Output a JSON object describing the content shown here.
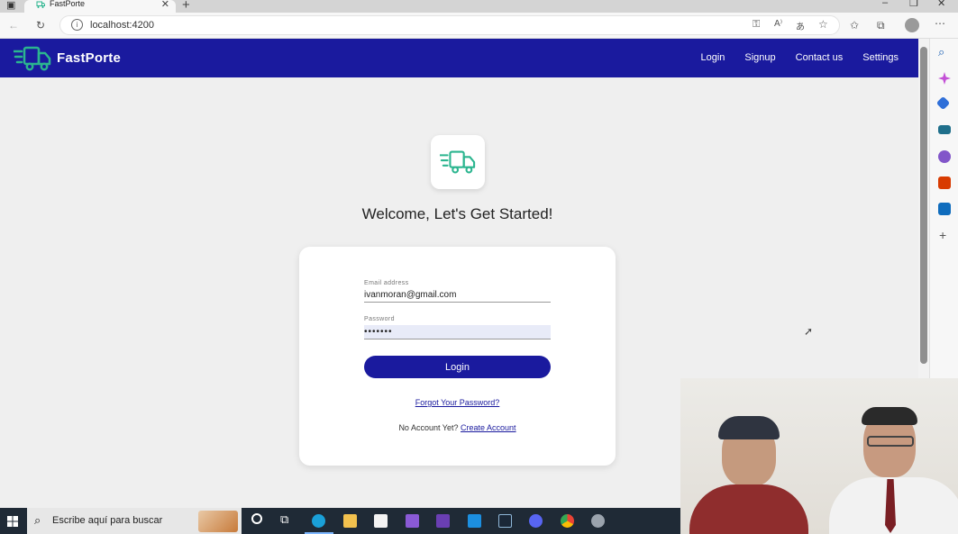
{
  "browser": {
    "tab_title": "FastPorte",
    "url": "localhost:4200"
  },
  "navbar": {
    "brand": "FastPorte",
    "links": [
      "Login",
      "Signup",
      "Contact us",
      "Settings"
    ],
    "bg_color": "#1a1a9e",
    "accent_color": "#2bb58f"
  },
  "main": {
    "welcome": "Welcome, Let's Get Started!",
    "form": {
      "email_label": "Email address",
      "email_value": "ivanmoran@gmail.com",
      "password_label": "Password",
      "password_value": "•••••••",
      "login_button": "Login",
      "forgot_link": "Forgot Your Password?",
      "no_account_text": "No Account Yet?",
      "create_account_link": "Create Account"
    }
  },
  "taskbar": {
    "search_placeholder": "Escribe aquí para buscar"
  }
}
